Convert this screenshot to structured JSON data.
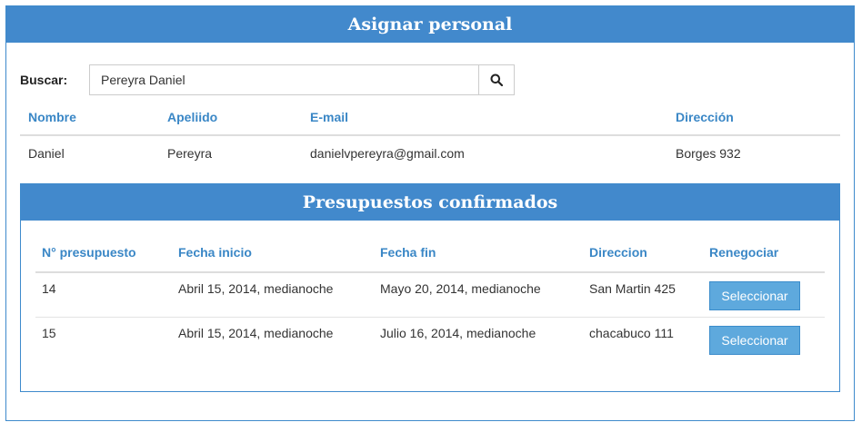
{
  "assign": {
    "title": "Asignar personal",
    "search": {
      "label": "Buscar:",
      "value": "Pereyra Daniel",
      "icon": "search-icon"
    },
    "people": {
      "headers": {
        "nombre": "Nombre",
        "apellido": "Apeliido",
        "email": "E-mail",
        "direccion": "Dirección"
      },
      "rows": [
        {
          "nombre": "Daniel",
          "apellido": "Pereyra",
          "email": "danielvpereyra@gmail.com",
          "direccion": "Borges 932"
        }
      ]
    }
  },
  "budgets": {
    "title": "Presupuestos confirmados",
    "headers": {
      "numero": "N° presupuesto",
      "inicio": "Fecha inicio",
      "fin": "Fecha fin",
      "direccion": "Direccion",
      "renegociar": "Renegociar"
    },
    "rows": [
      {
        "numero": "14",
        "inicio": "Abril 15, 2014, medianoche",
        "fin": "Mayo 20, 2014, medianoche",
        "direccion": "San Martin 425",
        "button": "Seleccionar"
      },
      {
        "numero": "15",
        "inicio": "Abril 15, 2014, medianoche",
        "fin": "Julio 16, 2014, medianoche",
        "direccion": "chacabuco 111",
        "button": "Seleccionar"
      }
    ]
  },
  "colors": {
    "accent": "#4289cc",
    "header_text": "#3a87c6",
    "button": "#5ea9dd"
  }
}
